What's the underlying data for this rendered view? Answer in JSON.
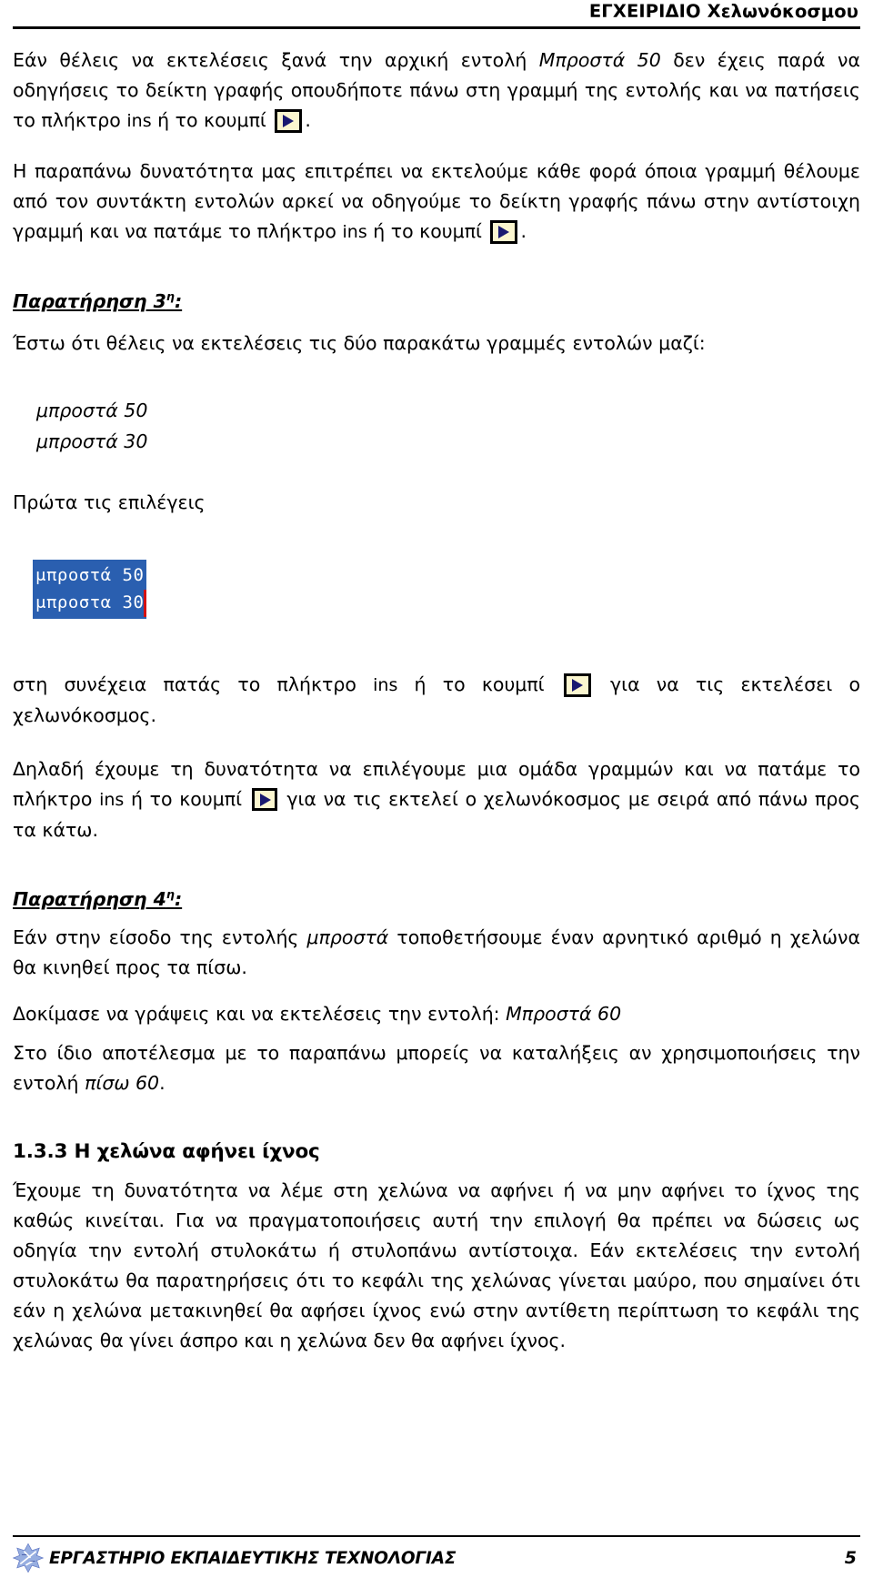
{
  "header": {
    "title": "ΕΓΧΕΙΡΙΔΙΟ Χελωνόκοσμου"
  },
  "body": {
    "p1_a": "Εάν θέλεις να εκτελέσεις ξανά την αρχική εντολή ",
    "p1_cmd": "Μπροστά 50",
    "p1_b": " δεν έχεις παρά να οδηγήσεις το δείκτη γραφής οπουδήποτε πάνω στη γραμμή της εντολής και να πατήσεις το πλήκτρο ",
    "p1_key": "ins",
    "p1_c": " ή το κουμπί ",
    "p1_d": ".",
    "p2_a": "Η παραπάνω δυνατότητα μας επιτρέπει να εκτελούμε κάθε φορά όποια γραμμή θέλουμε από τον συντάκτη εντολών αρκεί να οδηγούμε το δείκτη γραφής πάνω στην αντίστοιχη γραμμή και να πατάμε το πλήκτρο ",
    "p2_key": "ins",
    "p2_b": " ή το κουμπί ",
    "p2_c": ".",
    "obs3_label": "Παρατήρηση 3",
    "obs3_sup": "η",
    "obs3_colon": ":",
    "obs3_intro": "Έστω ότι θέλεις να εκτελέσεις τις δύο παρακάτω γραμμές εντολών μαζί:",
    "code_line_1": "μπροστά 50",
    "code_line_2": "μπροστά 30",
    "select_hint": "Πρώτα τις επιλέγεις",
    "editor_row_1": "μπροστά 50",
    "editor_row_2": "μπροστα 30",
    "p3_a": "στη συνέχεια πατάς το πλήκτρο ",
    "p3_key": "ins",
    "p3_b": " ή το κουμπί ",
    "p3_c": " για να τις εκτελέσει ο χελωνόκοσμος.",
    "p4_a": "Δηλαδή έχουμε τη δυνατότητα να επιλέγουμε μια ομάδα γραμμών και να πατάμε το πλήκτρο ",
    "p4_key": "ins",
    "p4_b": " ή το κουμπί ",
    "p4_c": " για να τις εκτελεί ο χελωνόκοσμος με σειρά από πάνω προς τα κάτω.",
    "obs4_label": "Παρατήρηση 4",
    "obs4_sup": "η",
    "obs4_colon": ":",
    "p5_a": "Εάν στην είσοδο της εντολής ",
    "p5_cmd": "μπροστά",
    "p5_b": " τοποθετήσουμε έναν αρνητικό αριθμό η χελώνα θα κινηθεί προς τα πίσω.",
    "p6_a": "Δοκίμασε να γράψεις και να εκτελέσεις την εντολή: ",
    "p6_cmd": "Μπροστά 60",
    "p7_a": "Στο ίδιο αποτέλεσμα με το παραπάνω μπορείς να καταλήξεις αν χρησιμοποιήσεις την εντολή ",
    "p7_cmd": "πίσω 60",
    "p7_b": ".",
    "sec_head": "1.3.3 Η χελώνα αφήνει ίχνος",
    "p8": "Έχουμε τη δυνατότητα να λέμε στη χελώνα να αφήνει ή να μην αφήνει το ίχνος της καθώς κινείται. Για να πραγματοποιήσεις αυτή την επιλογή θα πρέπει να δώσεις ως οδηγία την εντολή στυλοκάτω ή στυλοπάνω αντίστοιχα. Εάν εκτελέσεις την εντολή στυλοκάτω θα παρατηρήσεις ότι το κεφάλι της χελώνας γίνεται μαύρο, που σημαίνει ότι εάν η χελώνα μετακινηθεί θα αφήσει ίχνος ενώ στην αντίθετη περίπτωση το κεφάλι της χελώνας θα γίνει άσπρο και η χελώνα δεν θα αφήνει ίχνος."
  },
  "footer": {
    "lab_name": "ΕΡΓΑΣΤΗΡΙΟ ΕΚΠΑΙΔΕΥΤΙΚΗΣ ΤΕΧΝΟΛΟΓΙΑΣ",
    "page_number": "5"
  },
  "colors": {
    "selection_blue": "#2a5fb0",
    "caret_red": "#d51111",
    "button_face": "#fbf6cf",
    "button_arrow": "#191970",
    "logo_blue": "#97aee0",
    "rule_black": "#000000"
  }
}
